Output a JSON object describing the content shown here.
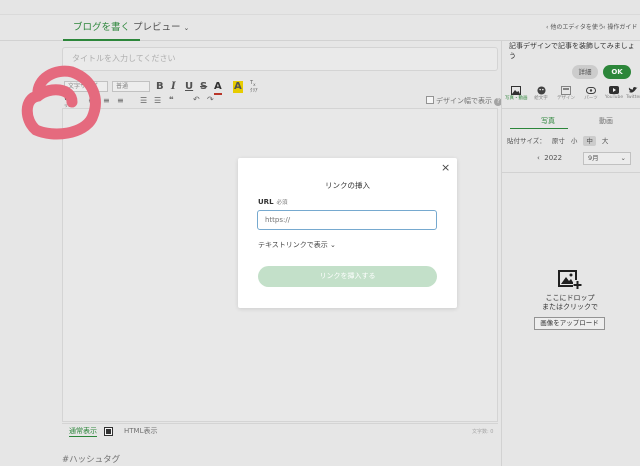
{
  "tabs": {
    "write": "ブログを書く",
    "preview": "プレビュー"
  },
  "top_links": {
    "other_editor": "他のエディタを使う",
    "guide": "操作ガイド"
  },
  "editor": {
    "title_placeholder": "タイトルを入力してください",
    "font_select": "文字サイズ",
    "size_select": "普通",
    "design_width_label": "デザイン幅で表示",
    "link_label": "リンク",
    "mode_normal": "通常表示",
    "mode_html": "HTML表示",
    "char_count": "文字数: 0",
    "hashtag": "#ハッシュタグ"
  },
  "sidebar": {
    "tip": "記事デザインで記事を装飾してみましょう",
    "detail_button": "詳細",
    "ok_button": "OK",
    "icons": [
      {
        "name": "photo-icon",
        "label": "写真・動画"
      },
      {
        "name": "emoji-icon",
        "label": "絵文字"
      },
      {
        "name": "design-icon",
        "label": "デザイン"
      },
      {
        "name": "parts-icon",
        "label": "パーツ"
      },
      {
        "name": "youtube-icon",
        "label": "YouTube"
      },
      {
        "name": "twitter-icon",
        "label": "Twitter"
      }
    ],
    "sub_tabs": {
      "photo": "写真",
      "video": "動画"
    },
    "size": {
      "label": "貼付サイズ：",
      "options": [
        "原寸",
        "小",
        "中",
        "大"
      ],
      "selected": "中"
    },
    "year": "2022",
    "month": "9月",
    "drop_line1": "ここにドロップ",
    "drop_line2": "またはクリックで",
    "upload_button": "画像をアップロード"
  },
  "modal": {
    "title": "リンクの挿入",
    "url_label": "URL",
    "required": "必須",
    "url_placeholder": "https://",
    "text_link": "テキストリンクで表示",
    "insert_button": "リンクを挿入する",
    "close": "×"
  },
  "colors": {
    "accent": "#2e8b3d",
    "disabled_button": "#c3e0c9",
    "annotation": "#e56a7e"
  }
}
